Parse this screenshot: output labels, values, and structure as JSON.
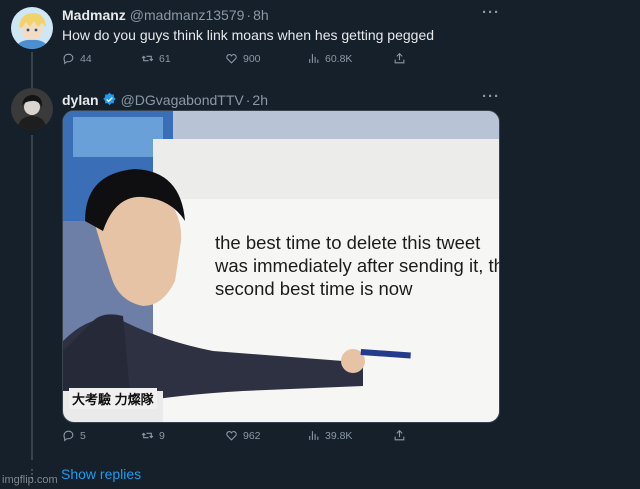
{
  "tweets": [
    {
      "name": "Madmanz",
      "handle": "@madmanz13579",
      "time": "8h",
      "text": "How do you guys think link moans when hes getting pegged",
      "replies": "44",
      "retweets": "61",
      "likes": "900",
      "views": "60.8K"
    },
    {
      "name": "dylan",
      "handle": "@DGvagabondTTV",
      "time": "2h",
      "media_caption": "the best time to delete this tweet was immediately after sending it, the second best time is now",
      "media_banner": "大考驗 力燦隊",
      "replies": "5",
      "retweets": "9",
      "likes": "962",
      "views": "39.8K"
    }
  ],
  "show_replies": "Show replies",
  "watermark": "imgflip.com",
  "colors": {
    "background": "#15202b",
    "accent": "#1d9bf0",
    "muted": "#8b98a5",
    "thread_line": "#38444d"
  },
  "icons": [
    "reply-icon",
    "retweet-icon",
    "like-icon",
    "views-icon",
    "share-icon",
    "more-icon",
    "verified-icon"
  ]
}
